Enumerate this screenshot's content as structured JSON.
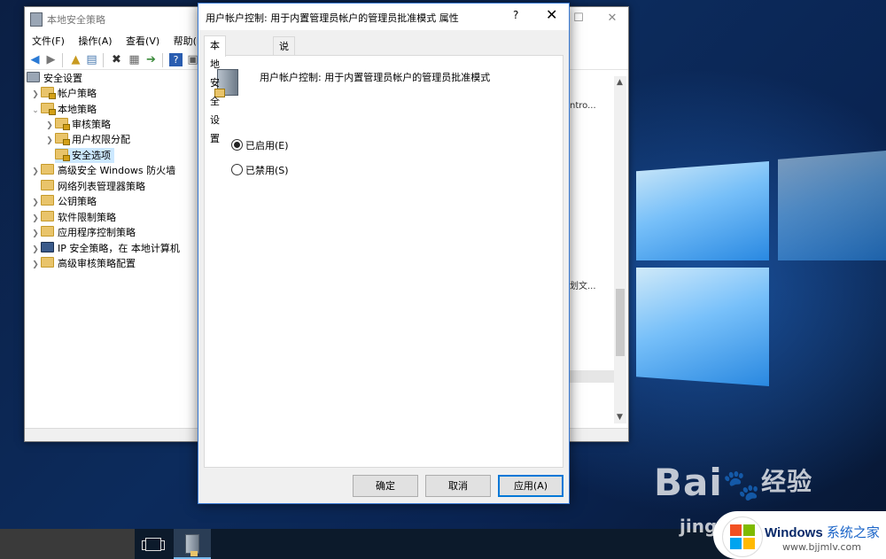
{
  "mmc": {
    "title": "本地安全策略",
    "menu": [
      "文件(F)",
      "操作(A)",
      "查看(V)",
      "帮助(H)"
    ],
    "tree": [
      {
        "label": "安全设置",
        "level": 0,
        "expanded": true
      },
      {
        "label": "帐户策略",
        "level": 1
      },
      {
        "label": "本地策略",
        "level": 1,
        "expanded": true
      },
      {
        "label": "审核策略",
        "level": 2
      },
      {
        "label": "用户权限分配",
        "level": 2
      },
      {
        "label": "安全选项",
        "level": 2,
        "selected": true
      },
      {
        "label": "高级安全 Windows 防火墙",
        "level": 1
      },
      {
        "label": "网络列表管理器策略",
        "level": 1
      },
      {
        "label": "公钥策略",
        "level": 1
      },
      {
        "label": "软件限制策略",
        "level": 1
      },
      {
        "label": "应用程序控制策略",
        "level": 1
      },
      {
        "label": "IP 安全策略，在 本地计算机",
        "level": 1
      },
      {
        "label": "高级审核策略配置",
        "level": 1
      }
    ],
    "right_snippets": [
      "ntro...",
      "划文..."
    ]
  },
  "dialog": {
    "title": "用户帐户控制: 用于内置管理员帐户的管理员批准模式 属性",
    "help": "?",
    "close": "✕",
    "tabs": [
      "本地安全设置",
      "说明"
    ],
    "policy_name": "用户帐户控制: 用于内置管理员帐户的管理员批准模式",
    "options": [
      {
        "label": "已启用(E)",
        "checked": true
      },
      {
        "label": "已禁用(S)",
        "checked": false
      }
    ],
    "buttons": {
      "ok": "确定",
      "cancel": "取消",
      "apply": "应用(A)"
    }
  },
  "watermark": {
    "baidu": "Bai",
    "baidu_cn": "经验",
    "baidu_sub": "jing",
    "windows": "Windows",
    "windows_cn": "系统之家",
    "url": "www.bjjmlv.com"
  },
  "colors": {
    "accent": "#0078d7",
    "selection": "#cce8ff",
    "taskbar": "#0c1a2b"
  }
}
